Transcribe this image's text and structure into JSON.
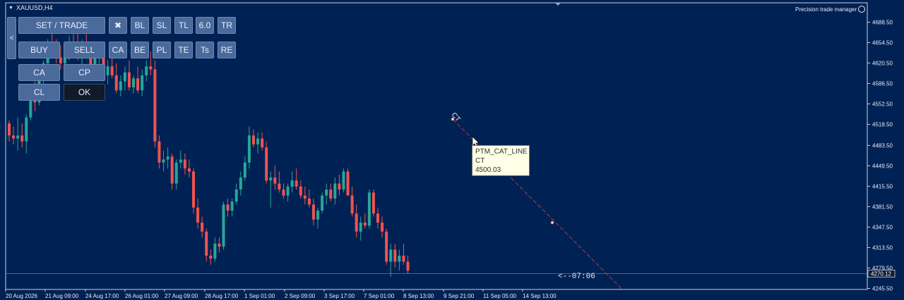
{
  "window": {
    "title": "XAUUSD,H4"
  },
  "ptm": {
    "title": "Precision  trade manager"
  },
  "buttons": {
    "collapse": "<",
    "set_trade": "SET / TRADE",
    "close_x": "✖",
    "bl": "BL",
    "sl": "SL",
    "tl": "TL",
    "lot": "6.0",
    "tr": "TR",
    "buy": "BUY",
    "sell": "SELL",
    "ca_top": "CA",
    "be": "BE",
    "pl": "PL",
    "te": "TE",
    "ts": "Ts",
    "re": "RE",
    "ca": "CA",
    "cp": "CP",
    "cl": "CL",
    "ok": "OK"
  },
  "tooltip": {
    "line1": "PTM_CAT_LINE",
    "line2": "CT",
    "line3": "4500.03"
  },
  "ct_label": "CT",
  "countdown": "<--07:06",
  "colors": {
    "background": "#002153",
    "bull": "#26a69a",
    "bear": "#ef5350",
    "grid_text": "#e8ecf5",
    "ct_line": "#c0392b"
  },
  "chart_data": {
    "type": "candlestick",
    "symbol": "XAUUSD",
    "timeframe": "H4",
    "ylim": [
      4240,
      4700
    ],
    "y_ticks": [
      4688.5,
      4654.5,
      4620.5,
      4586.5,
      4552.5,
      4518.5,
      4483.5,
      4449.5,
      4415.5,
      4381.5,
      4347.5,
      4313.5,
      4279.5,
      4245.5
    ],
    "y_tick_labels": [
      "4688.50",
      "4654.50",
      "4620.50",
      "4586.50",
      "4552.50",
      "4518.50",
      "4483.50",
      "4449.50",
      "4415.50",
      "4381.50",
      "4347.50",
      "4313.50",
      "4279.50",
      "4245.50"
    ],
    "x_tick_labels": [
      "20 Aug 2026",
      "21 Aug 09:00",
      "24 Aug 17:00",
      "26 Aug 01:00",
      "27 Aug 09:00",
      "28 Aug 17:00",
      "1 Sep 01:00",
      "2 Sep 09:00",
      "3 Sep 17:00",
      "7 Sep 01:00",
      "8 Sep 13:00",
      "9 Sep 21:00",
      "11 Sep 05:00",
      "14 Sep 13:00"
    ],
    "current_price": 4270.12,
    "current_price_label": "4270.12",
    "ct_line": {
      "name": "PTM_CAT_LINE",
      "label": "CT",
      "start_price": 4527,
      "end_price": 4245,
      "marker_price": 4355
    },
    "candles": [
      [
        4520,
        4525,
        4490,
        4500
      ],
      [
        4500,
        4515,
        4485,
        4495
      ],
      [
        4495,
        4530,
        4475,
        4500
      ],
      [
        4500,
        4520,
        4480,
        4490
      ],
      [
        4490,
        4535,
        4470,
        4530
      ],
      [
        4530,
        4575,
        4525,
        4565
      ],
      [
        4565,
        4590,
        4540,
        4555
      ],
      [
        4555,
        4600,
        4550,
        4595
      ],
      [
        4595,
        4625,
        4585,
        4620
      ],
      [
        4620,
        4660,
        4610,
        4650
      ],
      [
        4650,
        4675,
        4630,
        4640
      ],
      [
        4640,
        4660,
        4620,
        4630
      ],
      [
        4630,
        4650,
        4610,
        4620
      ],
      [
        4620,
        4645,
        4600,
        4635
      ],
      [
        4635,
        4665,
        4625,
        4655
      ],
      [
        4655,
        4680,
        4640,
        4650
      ],
      [
        4650,
        4670,
        4625,
        4635
      ],
      [
        4635,
        4660,
        4615,
        4650
      ],
      [
        4650,
        4670,
        4630,
        4640
      ],
      [
        4640,
        4655,
        4610,
        4615
      ],
      [
        4615,
        4640,
        4600,
        4630
      ],
      [
        4630,
        4650,
        4615,
        4640
      ],
      [
        4640,
        4655,
        4590,
        4600
      ],
      [
        4600,
        4625,
        4585,
        4615
      ],
      [
        4615,
        4640,
        4595,
        4600
      ],
      [
        4600,
        4620,
        4570,
        4575
      ],
      [
        4575,
        4600,
        4565,
        4590
      ],
      [
        4590,
        4615,
        4575,
        4605
      ],
      [
        4605,
        4625,
        4575,
        4580
      ],
      [
        4580,
        4600,
        4570,
        4595
      ],
      [
        4595,
        4615,
        4570,
        4575
      ],
      [
        4575,
        4610,
        4565,
        4600
      ],
      [
        4600,
        4625,
        4590,
        4615
      ],
      [
        4615,
        4640,
        4600,
        4610
      ],
      [
        4610,
        4625,
        4480,
        4490
      ],
      [
        4490,
        4500,
        4445,
        4455
      ],
      [
        4455,
        4475,
        4440,
        4460
      ],
      [
        4460,
        4480,
        4445,
        4465
      ],
      [
        4465,
        4470,
        4410,
        4420
      ],
      [
        4420,
        4460,
        4410,
        4455
      ],
      [
        4455,
        4475,
        4445,
        4460
      ],
      [
        4460,
        4470,
        4435,
        4445
      ],
      [
        4445,
        4460,
        4430,
        4440
      ],
      [
        4440,
        4445,
        4370,
        4380
      ],
      [
        4380,
        4395,
        4345,
        4355
      ],
      [
        4355,
        4365,
        4330,
        4340
      ],
      [
        4340,
        4345,
        4290,
        4300
      ],
      [
        4300,
        4310,
        4285,
        4295
      ],
      [
        4295,
        4330,
        4290,
        4320
      ],
      [
        4320,
        4330,
        4305,
        4315
      ],
      [
        4315,
        4390,
        4310,
        4385
      ],
      [
        4385,
        4395,
        4365,
        4375
      ],
      [
        4375,
        4395,
        4365,
        4390
      ],
      [
        4390,
        4420,
        4385,
        4410
      ],
      [
        4410,
        4440,
        4400,
        4430
      ],
      [
        4430,
        4465,
        4425,
        4455
      ],
      [
        4455,
        4515,
        4445,
        4500
      ],
      [
        4500,
        4510,
        4480,
        4485
      ],
      [
        4485,
        4505,
        4470,
        4495
      ],
      [
        4495,
        4505,
        4475,
        4480
      ],
      [
        4480,
        4490,
        4420,
        4425
      ],
      [
        4425,
        4440,
        4380,
        4430
      ],
      [
        4430,
        4450,
        4410,
        4420
      ],
      [
        4420,
        4440,
        4405,
        4410
      ],
      [
        4410,
        4420,
        4395,
        4400
      ],
      [
        4400,
        4420,
        4390,
        4415
      ],
      [
        4415,
        4440,
        4405,
        4425
      ],
      [
        4425,
        4445,
        4410,
        4415
      ],
      [
        4415,
        4425,
        4395,
        4400
      ],
      [
        4400,
        4415,
        4385,
        4395
      ],
      [
        4395,
        4410,
        4380,
        4385
      ],
      [
        4385,
        4395,
        4350,
        4360
      ],
      [
        4360,
        4380,
        4345,
        4375
      ],
      [
        4375,
        4405,
        4370,
        4400
      ],
      [
        4400,
        4420,
        4385,
        4410
      ],
      [
        4410,
        4420,
        4390,
        4395
      ],
      [
        4395,
        4430,
        4385,
        4420
      ],
      [
        4420,
        4435,
        4400,
        4410
      ],
      [
        4410,
        4445,
        4405,
        4440
      ],
      [
        4440,
        4445,
        4400,
        4400
      ],
      [
        4400,
        4415,
        4365,
        4370
      ],
      [
        4370,
        4385,
        4330,
        4340
      ],
      [
        4340,
        4365,
        4325,
        4355
      ],
      [
        4355,
        4370,
        4345,
        4350
      ],
      [
        4350,
        4410,
        4345,
        4405
      ],
      [
        4405,
        4410,
        4365,
        4370
      ],
      [
        4370,
        4380,
        4345,
        4355
      ],
      [
        4355,
        4365,
        4330,
        4340
      ],
      [
        4340,
        4345,
        4285,
        4290
      ],
      [
        4290,
        4320,
        4265,
        4310
      ],
      [
        4310,
        4320,
        4280,
        4290
      ],
      [
        4290,
        4310,
        4275,
        4300
      ],
      [
        4300,
        4320,
        4285,
        4290
      ],
      [
        4290,
        4300,
        4270,
        4275
      ]
    ]
  }
}
